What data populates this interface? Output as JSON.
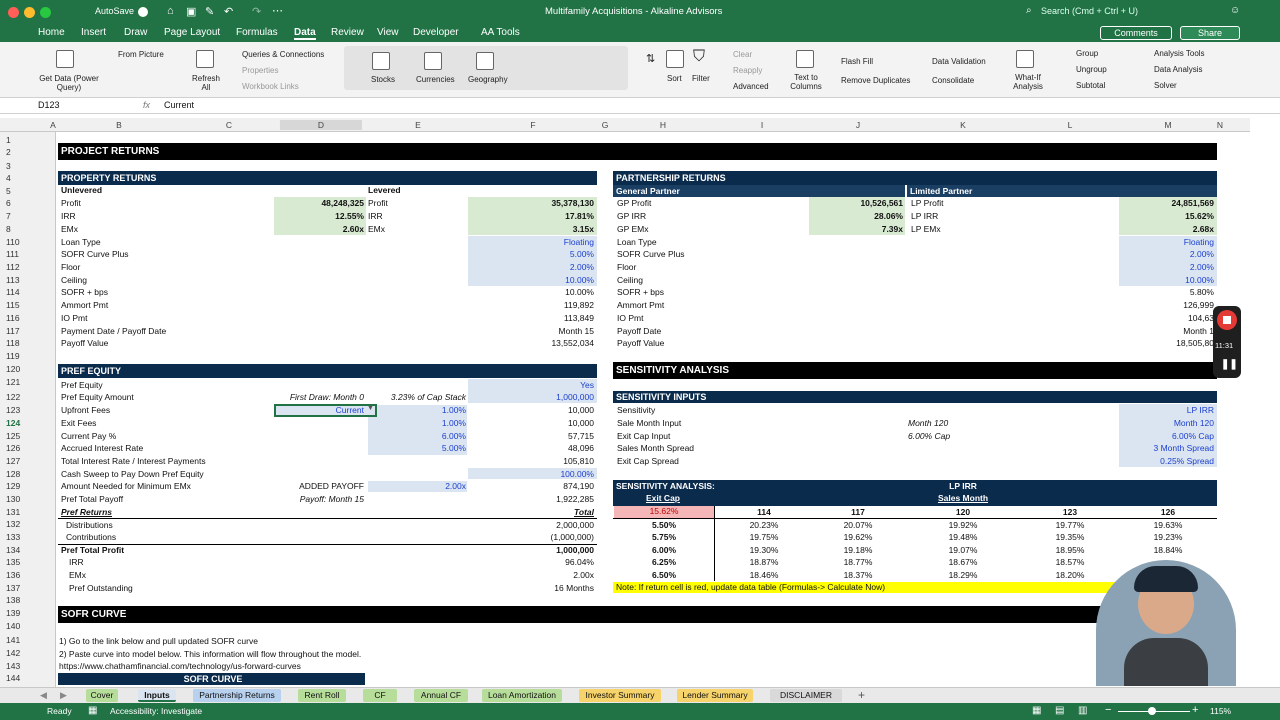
{
  "window": {
    "title": "Multifamily Acquisitions - Alkaline Advisors",
    "autosave": "AutoSave",
    "search_placeholder": "Search (Cmd + Ctrl + U)",
    "comments": "Comments",
    "share": "Share"
  },
  "ribbon_tabs": [
    "Home",
    "Insert",
    "Draw",
    "Page Layout",
    "Formulas",
    "Data",
    "Review",
    "View",
    "Developer",
    "AA Tools"
  ],
  "ribbon": {
    "get_data": "Get Data (Power Query)",
    "from_picture": "From Picture",
    "refresh_all": "Refresh All",
    "queries": "Queries & Connections",
    "properties": "Properties",
    "workbook_links": "Workbook Links",
    "stocks": "Stocks",
    "currencies": "Currencies",
    "geography": "Geography",
    "sort": "Sort",
    "filter": "Filter",
    "clear": "Clear",
    "reapply": "Reapply",
    "advanced": "Advanced",
    "text_to_columns": "Text to Columns",
    "flash_fill": "Flash Fill",
    "remove_duplicates": "Remove Duplicates",
    "data_validation": "Data Validation",
    "consolidate": "Consolidate",
    "what_if": "What-If Analysis",
    "group": "Group",
    "ungroup": "Ungroup",
    "subtotal": "Subtotal",
    "analysis_tools": "Analysis Tools",
    "data_analysis": "Data Analysis",
    "solver": "Solver"
  },
  "formula_bar": {
    "name_box": "D123",
    "fx": "fx",
    "value": "Current"
  },
  "columns": [
    "A",
    "B",
    "C",
    "D",
    "E",
    "F",
    "G",
    "H",
    "I",
    "J",
    "K",
    "L",
    "M",
    "N"
  ],
  "rows": [
    "1",
    "2",
    "3",
    "4",
    "5",
    "6",
    "7",
    "8",
    "110",
    "111",
    "112",
    "113",
    "114",
    "115",
    "116",
    "117",
    "118",
    "119",
    "120",
    "121",
    "122",
    "123",
    "124",
    "125",
    "126",
    "127",
    "128",
    "129",
    "130",
    "131",
    "132",
    "133",
    "134",
    "135",
    "136",
    "137",
    "138",
    "139",
    "140",
    "141",
    "142",
    "143",
    "144"
  ],
  "project_returns": "PROJECT RETURNS",
  "property_returns": {
    "title": "PROPERTY RETURNS",
    "unlevered": "Unlevered",
    "levered": "Levered",
    "rows": [
      {
        "l1": "Profit",
        "v1": "48,248,325",
        "l2": "Profit",
        "v2": "35,378,130"
      },
      {
        "l1": "IRR",
        "v1": "12.55%",
        "l2": "IRR",
        "v2": "17.81%"
      },
      {
        "l1": "EMx",
        "v1": "2.60x",
        "l2": "EMx",
        "v2": "3.15x"
      }
    ]
  },
  "partnership_returns": {
    "title": "PARTNERSHIP RETURNS",
    "gp": "General Partner",
    "lp": "Limited Partner",
    "rows": [
      {
        "l1": "GP Profit",
        "v1": "10,526,561",
        "l2": "LP Profit",
        "v2": "24,851,569"
      },
      {
        "l1": "GP IRR",
        "v1": "28.06%",
        "l2": "LP IRR",
        "v2": "15.62%"
      },
      {
        "l1": "GP EMx",
        "v1": "7.39x",
        "l2": "LP EMx",
        "v2": "2.68x"
      }
    ]
  },
  "loan_left": [
    {
      "l": "Loan Type",
      "v": "Floating",
      "input": true
    },
    {
      "l": "SOFR Curve Plus",
      "v": "5.00%",
      "input": true
    },
    {
      "l": "Floor",
      "v": "2.00%",
      "input": true
    },
    {
      "l": "Ceiling",
      "v": "10.00%",
      "input": true
    },
    {
      "l": "SOFR + bps",
      "v": "10.00%",
      "input": false
    },
    {
      "l": "Ammort Pmt",
      "v": "119,892",
      "input": false
    },
    {
      "l": "IO Pmt",
      "v": "113,849",
      "input": false
    },
    {
      "l": "Payment Date / Payoff Date",
      "v": "Month 15",
      "input": false
    },
    {
      "l": "Payoff Value",
      "v": "13,552,034",
      "input": false
    }
  ],
  "loan_right": [
    {
      "l": "Loan Type",
      "v": "Floating",
      "input": true
    },
    {
      "l": "SOFR Curve Plus",
      "v": "2.00%",
      "input": true
    },
    {
      "l": "Floor",
      "v": "2.00%",
      "input": true
    },
    {
      "l": "Ceiling",
      "v": "10.00%",
      "input": true
    },
    {
      "l": "SOFR + bps",
      "v": "5.80%",
      "input": false
    },
    {
      "l": "Ammort Pmt",
      "v": "126,999",
      "input": false
    },
    {
      "l": "IO Pmt",
      "v": "104,63",
      "input": false
    },
    {
      "l": "Payoff Date",
      "v": "Month 1",
      "input": false
    },
    {
      "l": "Payoff Value",
      "v": "18,505,80",
      "input": false
    }
  ],
  "pref": {
    "title": "PREF EQUITY",
    "rows": [
      {
        "l": "Pref Equity",
        "d": "",
        "e": "",
        "f": "Yes",
        "fin": true
      },
      {
        "l": "Pref Equity Amount",
        "d": "First Draw: Month 0",
        "e": "3.23% of Cap Stack",
        "f": "1,000,000",
        "fin": true
      },
      {
        "l": "Upfront Fees",
        "d": "Current",
        "e": "1.00%",
        "f": "10,000",
        "fin": false
      },
      {
        "l": "Exit Fees",
        "d": "",
        "e": "1.00%",
        "f": "10,000",
        "fin": false
      },
      {
        "l": "Current Pay %",
        "d": "",
        "e": "6.00%",
        "f": "57,715",
        "fin": false
      },
      {
        "l": "Accrued Interest Rate",
        "d": "",
        "e": "5.00%",
        "f": "48,096",
        "fin": false
      },
      {
        "l": "Total Interest Rate / Interest Payments",
        "d": "",
        "e": "",
        "f": "105,810",
        "fin": false
      },
      {
        "l": "Cash Sweep to Pay Down Pref Equity",
        "d": "",
        "e": "",
        "f": "100.00%",
        "fin": true
      },
      {
        "l": "Amount Needed for Minimum EMx",
        "d": "ADDED PAYOFF",
        "e": "2.00x",
        "f": "874,190",
        "fin": false
      },
      {
        "l": "Pref Total Payoff",
        "d": "Payoff: Month 15",
        "e": "",
        "f": "1,922,285",
        "fin": false
      }
    ],
    "returns_label": "Pref Returns",
    "total_label": "Total",
    "returns": [
      {
        "l": "Distributions",
        "v": "2,000,000"
      },
      {
        "l": "Contributions",
        "v": "(1,000,000)"
      },
      {
        "l": "Pref Total Profit",
        "v": "1,000,000"
      },
      {
        "l": "IRR",
        "v": "96.04%"
      },
      {
        "l": "EMx",
        "v": "2.00x"
      },
      {
        "l": "Pref Outstanding",
        "v": "16 Months"
      }
    ]
  },
  "sensitivity": {
    "title": "SENSITIVITY ANALYSIS",
    "inputs_title": "SENSITIVITY INPUTS",
    "inputs": [
      {
        "l": "Sensitivity",
        "m": "",
        "v": "LP IRR"
      },
      {
        "l": "Sale Month Input",
        "m": "Month 120",
        "v": "Month 120"
      },
      {
        "l": "Exit Cap Input",
        "m": "6.00% Cap",
        "v": "6.00% Cap"
      },
      {
        "l": "Sales Month Spread",
        "m": "",
        "v": "3 Month Spread"
      },
      {
        "l": "Exit Cap Spread",
        "m": "",
        "v": "0.25% Spread"
      }
    ],
    "analysis_title": "SENSITIVITY ANALYSIS:",
    "metric": "LP IRR",
    "row_axis": "Exit Cap",
    "col_axis": "Sales Month",
    "corner": "15.62%",
    "months": [
      "114",
      "117",
      "120",
      "123",
      "126"
    ],
    "table": [
      {
        "cap": "5.50%",
        "vals": [
          "20.23%",
          "20.07%",
          "19.92%",
          "19.77%",
          "19.63%"
        ]
      },
      {
        "cap": "5.75%",
        "vals": [
          "19.75%",
          "19.62%",
          "19.48%",
          "19.35%",
          "19.23%"
        ]
      },
      {
        "cap": "6.00%",
        "vals": [
          "19.30%",
          "19.18%",
          "19.07%",
          "18.95%",
          "18.84%"
        ]
      },
      {
        "cap": "6.25%",
        "vals": [
          "18.87%",
          "18.77%",
          "18.67%",
          "18.57%",
          ""
        ]
      },
      {
        "cap": "6.50%",
        "vals": [
          "18.46%",
          "18.37%",
          "18.29%",
          "18.20%",
          ""
        ]
      }
    ],
    "note": "Note: If return cell is red, update data table (Formulas-> Calculate Now)"
  },
  "sofr": {
    "title": "SOFR CURVE",
    "steps": [
      "1) Go to the link below and pull updated SOFR curve",
      "2) Paste curve into model below. This information will flow throughout the model."
    ],
    "link": "https://www.chathamfinancial.com/technology/us-forward-curves",
    "table_title": "SOFR CURVE"
  },
  "sheet_tabs": [
    {
      "name": "Cover",
      "bg": "#b7dd9b"
    },
    {
      "name": "Inputs",
      "bg": "#dbe5f1",
      "active": true
    },
    {
      "name": "Partnership Returns",
      "bg": "#b7d1ee"
    },
    {
      "name": "Rent Roll",
      "bg": "#b7dd9b"
    },
    {
      "name": "CF",
      "bg": "#b7dd9b"
    },
    {
      "name": "Annual CF",
      "bg": "#b7dd9b"
    },
    {
      "name": "Loan Amortization",
      "bg": "#b7dd9b"
    },
    {
      "name": "Investor Summary",
      "bg": "#f6d36b"
    },
    {
      "name": "Lender Summary",
      "bg": "#f6d36b"
    },
    {
      "name": "DISCLAIMER",
      "bg": "#d9d9d9"
    }
  ],
  "status": {
    "ready": "Ready",
    "accessibility": "Accessibility: Investigate",
    "zoom": "115%"
  },
  "recording": {
    "time": "11:31"
  },
  "colors": {
    "excel_green": "#217346",
    "header_navy": "#0b2b4d",
    "input_blue": "#1a3ecf"
  }
}
